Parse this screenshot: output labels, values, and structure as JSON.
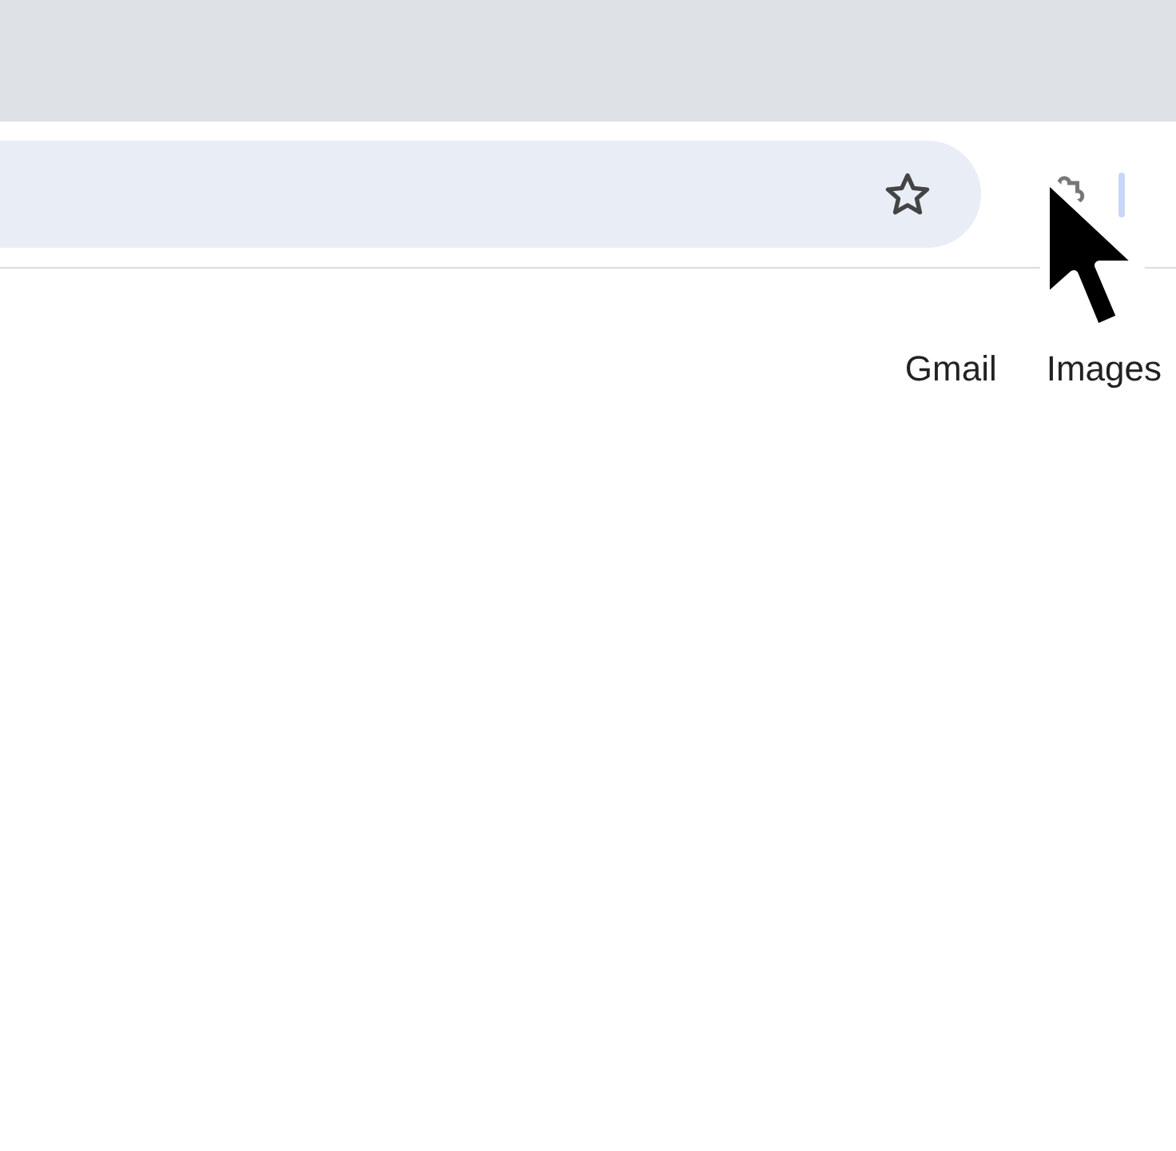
{
  "header_links": [
    {
      "label": "Gmail"
    },
    {
      "label": "Images"
    }
  ]
}
